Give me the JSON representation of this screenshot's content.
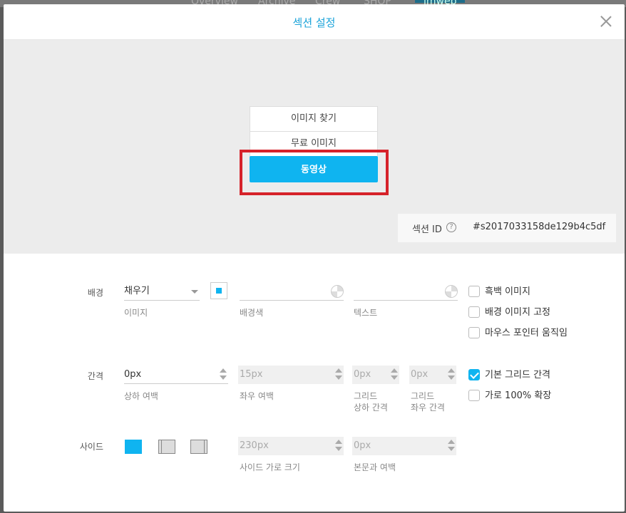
{
  "background_nav": {
    "items": [
      "Overview",
      "Archive",
      "Crew",
      "SHOP",
      "imweb"
    ]
  },
  "modal": {
    "title": "섹션 설정",
    "image_menu": [
      "이미지 찾기",
      "무료 이미지",
      "동영상"
    ],
    "section_id_label": "섹션 ID",
    "help_icon": "?",
    "section_id_value": "#s2017033158de129b4c5df"
  },
  "background": {
    "label": "배경",
    "fill_select": "채우기",
    "image_label": "이미지",
    "bgcolor_label": "배경색",
    "text_label": "텍스트",
    "checkboxes": [
      {
        "label": "흑백 이미지",
        "checked": false
      },
      {
        "label": "배경 이미지 고정",
        "checked": false
      },
      {
        "label": "마우스 포인터 움직임",
        "checked": false
      }
    ]
  },
  "spacing": {
    "label": "간격",
    "vertical_value": "0px",
    "vertical_label": "상하 여백",
    "horizontal_value": "15px",
    "horizontal_label": "좌우 여백",
    "grid_v_value": "0px",
    "grid_v_label1": "그리드",
    "grid_v_label2": "상하 간격",
    "grid_h_value": "0px",
    "grid_h_label1": "그리드",
    "grid_h_label2": "좌우 간격",
    "checkboxes": [
      {
        "label": "기본 그리드 간격",
        "checked": true
      },
      {
        "label": "가로 100% 확장",
        "checked": false
      }
    ]
  },
  "side": {
    "label": "사이드",
    "width_value": "230px",
    "width_label": "사이드 가로 크기",
    "body_margin_value": "0px",
    "body_margin_label": "본문과 여백"
  },
  "colors": {
    "accent": "#0fb4f0",
    "title": "#1aa3d9",
    "highlight": "#d6222a"
  }
}
